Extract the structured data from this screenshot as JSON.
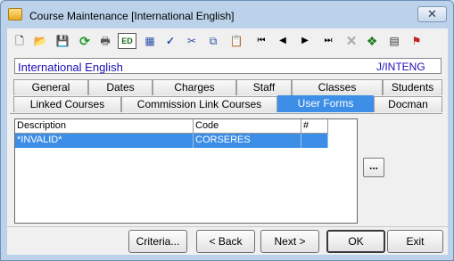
{
  "window": {
    "title": "Course Maintenance  [International English]",
    "close_label": "✕"
  },
  "toolbar": {
    "items": [
      {
        "name": "new-icon",
        "glyph": "🗋"
      },
      {
        "name": "open-icon",
        "glyph": "📂"
      },
      {
        "name": "save-icon",
        "glyph": "💾"
      },
      {
        "name": "refresh-icon",
        "glyph": "⟳"
      },
      {
        "name": "print-icon",
        "glyph": "🖶"
      },
      {
        "name": "edit-mode-icon",
        "glyph": "ED"
      },
      {
        "name": "calculator-icon",
        "glyph": "▦"
      },
      {
        "name": "spellcheck-icon",
        "glyph": "✓"
      },
      {
        "name": "cut-icon",
        "glyph": "✂"
      },
      {
        "name": "copy-icon",
        "glyph": "⧉"
      },
      {
        "name": "paste-icon",
        "glyph": "📋"
      },
      {
        "name": "first-record-icon",
        "glyph": "⏮"
      },
      {
        "name": "previous-record-icon",
        "glyph": "◀"
      },
      {
        "name": "next-record-icon",
        "glyph": "▶"
      },
      {
        "name": "last-record-icon",
        "glyph": "⏭"
      },
      {
        "name": "delete-icon",
        "glyph": "✕"
      },
      {
        "name": "group-icon",
        "glyph": "❖"
      },
      {
        "name": "film-icon",
        "glyph": "▤"
      },
      {
        "name": "clapper-icon",
        "glyph": "⚑"
      }
    ]
  },
  "record": {
    "name": "International English",
    "code": "J/INTENG"
  },
  "tabs": {
    "row1": [
      "General",
      "Dates",
      "Charges",
      "Staff",
      "Classes",
      "Students"
    ],
    "row2": [
      "Linked Courses",
      "Commission Link Courses",
      "User Forms",
      "Docman"
    ]
  },
  "grid": {
    "columns": [
      "Description",
      "Code",
      "#"
    ],
    "rows": [
      {
        "description": "*INVALID*",
        "code": "CORSERES",
        "num": ""
      }
    ]
  },
  "ellipsis_label": "...",
  "buttons": {
    "criteria": "Criteria...",
    "back": "< Back",
    "next": "Next >",
    "ok": "OK",
    "exit": "Exit"
  },
  "colors": {
    "selection": "#3d8ee6",
    "record_text": "#1a0fb5"
  }
}
